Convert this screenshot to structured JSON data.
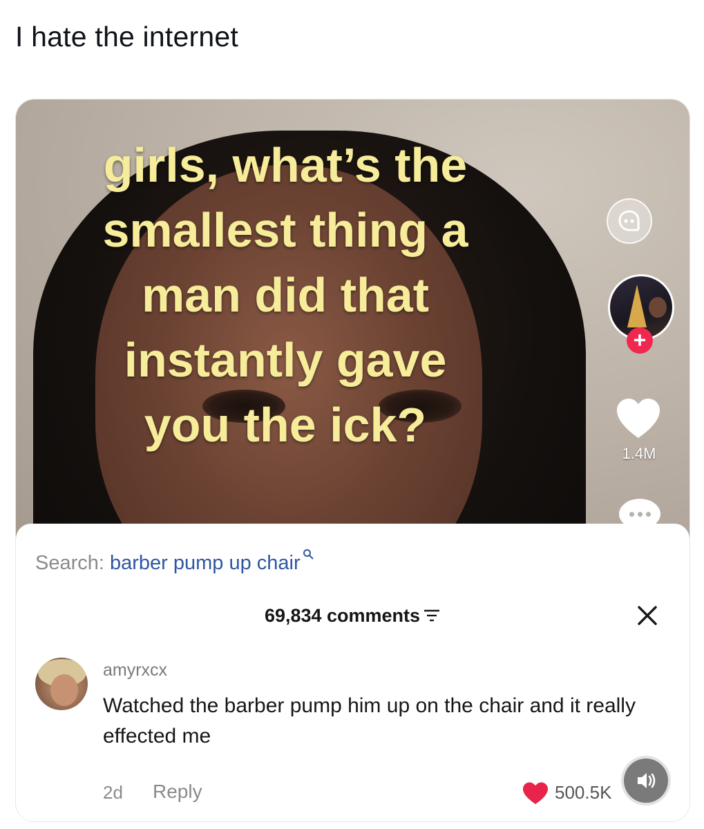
{
  "post": {
    "caption": "I hate the internet"
  },
  "video": {
    "overlay_lines": [
      "girls, what’s the",
      "smallest thing a",
      "man did that",
      "instantly gave",
      "you the ick?"
    ],
    "like_count": "1.4M",
    "follow_symbol": "+"
  },
  "comments_sheet": {
    "search_prefix": "Search: ",
    "search_query": "barber pump up chair",
    "comments_count_label": "69,834 comments",
    "comment": {
      "username": "amyrxcx",
      "text": "Watched the barber pump him up on the chair and it really effected me",
      "time": "2d",
      "reply_label": "Reply",
      "like_count": "500.5K"
    }
  },
  "colors": {
    "overlay_text": "#f6ec9a",
    "search_query": "#2f56a3",
    "like_heart": "#e8244a",
    "follow_badge": "#f0284f"
  },
  "icons": {
    "captions": "captions-face-icon",
    "follow": "plus-icon",
    "like": "heart-icon",
    "more": "ellipsis-icon",
    "search": "search-icon",
    "filter": "filter-icon",
    "close": "close-icon",
    "sound": "speaker-icon"
  }
}
